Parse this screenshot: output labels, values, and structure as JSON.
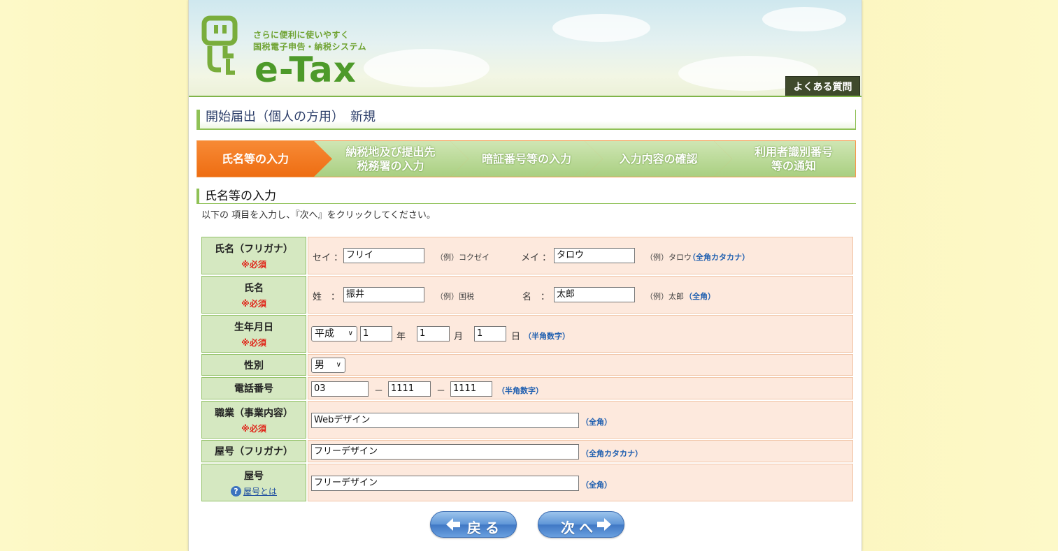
{
  "header": {
    "tagline_line1": "さらに便利に使いやすく",
    "tagline_line2": "国税電子申告・納税システム",
    "logo_text": "e-Tax",
    "faq_button": "よくある質問"
  },
  "page_title": "開始届出（個人の方用）　新規",
  "steps": [
    {
      "label": "氏名等の入力",
      "active": true
    },
    {
      "label": "納税地及び提出先\n税務署の入力",
      "active": false
    },
    {
      "label": "暗証番号等の入力",
      "active": false
    },
    {
      "label": "入力内容の確認",
      "active": false
    },
    {
      "label": "利用者識別番号\n等の通知",
      "active": false
    }
  ],
  "section": {
    "title": "氏名等の入力",
    "instruction": "以下の 項目を入力し、『次へ』をクリックしてください。"
  },
  "form": {
    "required_mark": "※必須",
    "kana_name": {
      "label": "氏名（フリガナ）",
      "sei_label": "セイ ：",
      "sei_value": "フリイ",
      "sei_example": "（例）コクゼイ",
      "mei_label": "メイ ：",
      "mei_value": "タロウ",
      "mei_example": "（例）タロウ",
      "note": "（全角カタカナ）"
    },
    "name": {
      "label": "氏名",
      "sei_label": "姓　：",
      "sei_value": "振井",
      "sei_example": "（例）国税",
      "mei_label": "名　：",
      "mei_value": "太郎",
      "mei_example": "（例）太郎",
      "note": "（全角）"
    },
    "birthdate": {
      "label": "生年月日",
      "era": "平成",
      "year": "1",
      "year_unit": "年",
      "month": "1",
      "month_unit": "月",
      "day": "1",
      "day_unit": "日",
      "note": "（半角数字）"
    },
    "gender": {
      "label": "性別",
      "value": "男"
    },
    "phone": {
      "label": "電話番号",
      "part1": "03",
      "part2": "1111",
      "part3": "1111",
      "separator": "－",
      "note": "（半角数字）"
    },
    "occupation": {
      "label": "職業（事業内容）",
      "value": "Webデザイン",
      "note": "（全角）"
    },
    "trade_name_kana": {
      "label": "屋号（フリガナ）",
      "value": "フリーデザイン",
      "note": "（全角カタカナ）"
    },
    "trade_name": {
      "label": "屋号",
      "help_link": "屋号とは",
      "value": "フリーデザイン",
      "note": "（全角）"
    }
  },
  "buttons": {
    "back": "戻る",
    "next": "次へ"
  },
  "colors": {
    "active_step": "#f47a1f",
    "inactive_step": "#b5d691",
    "label_cell": "#d5e8c1",
    "value_cell": "#fde9dd",
    "required": "#e0261a",
    "note": "#1f5fb0",
    "nav_button": "#4f87d0"
  }
}
